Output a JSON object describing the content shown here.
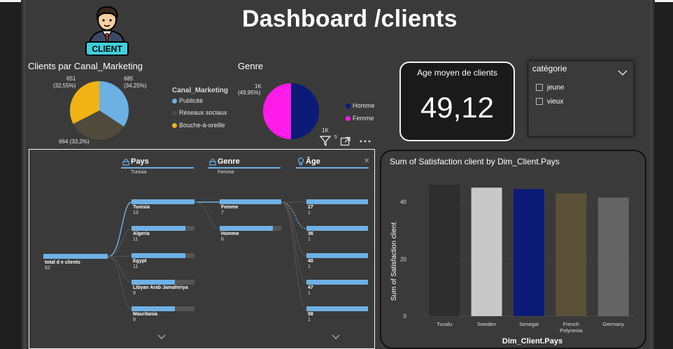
{
  "header": {
    "title": "Dashboard /clients",
    "logo_text": "CLIENT"
  },
  "canal": {
    "title": "Clients par Canal_Marketing",
    "legend_title": "Canal_Marketing",
    "slices": [
      {
        "name": "Publicité",
        "value": 685,
        "label": "685",
        "pct": "(34,25%)",
        "color": "#6cb0e4"
      },
      {
        "name": "Réseaux sociaux",
        "value": 664,
        "label": "664 (33,2%)",
        "pct": "",
        "color": "#4f4a3b"
      },
      {
        "name": "Bouche-à-oreille",
        "value": 651,
        "label": "651",
        "pct": "(32,55%)",
        "color": "#f1b214"
      }
    ]
  },
  "genre": {
    "title": "Genre",
    "slices": [
      {
        "name": "Homme",
        "value": 1000,
        "color": "#0c1a78"
      },
      {
        "name": "Femme",
        "value": 999,
        "color": "#ff1be9"
      }
    ],
    "label_top": "1K",
    "label_top_pct": "(49,95%)",
    "label_bottom": "1K",
    "label_bottom_suffix": "5"
  },
  "kpi": {
    "label": "Age moyen de clients",
    "value": "49,12"
  },
  "slicer": {
    "title": "catégorie",
    "options": [
      "jeune",
      "vieux"
    ]
  },
  "tree": {
    "root": {
      "label": "total d e clients",
      "value": "62"
    },
    "columns": [
      {
        "header": "Pays",
        "sub": "Tunisia"
      },
      {
        "header": "Genre",
        "sub": "Femme"
      },
      {
        "header": "Âge",
        "sub": ""
      }
    ],
    "pays": [
      {
        "label": "Tunisia",
        "value": "13",
        "fill": 1.0
      },
      {
        "label": "Algeria",
        "value": "11",
        "fill": 0.85
      },
      {
        "label": "Egypt",
        "value": "11",
        "fill": 0.85
      },
      {
        "label": "Libyan Arab Jamahiriya",
        "value": "9",
        "fill": 0.69
      },
      {
        "label": "Mauritania",
        "value": "9",
        "fill": 0.69
      }
    ],
    "genre": [
      {
        "label": "Femme",
        "value": "7",
        "fill": 1.0
      },
      {
        "label": "Homme",
        "value": "6",
        "fill": 0.86
      }
    ],
    "age": [
      {
        "label": "27",
        "value": "1",
        "fill": 1.0
      },
      {
        "label": "36",
        "value": "1",
        "fill": 1.0
      },
      {
        "label": "40",
        "value": "1",
        "fill": 1.0
      },
      {
        "label": "47",
        "value": "1",
        "fill": 1.0
      },
      {
        "label": "58",
        "value": "1",
        "fill": 1.0
      }
    ]
  },
  "chart_data": {
    "type": "bar",
    "title": "Sum of Satisfaction client by Dim_Client.Pays",
    "xlabel": "Dim_Client.Pays",
    "ylabel": "Sum of Satisfaction client",
    "categories": [
      "Tuvalu",
      "Sweden",
      "Senegal",
      "French Polynesia",
      "Germany"
    ],
    "values": [
      46,
      45,
      44.5,
      43,
      41.5
    ],
    "colors": [
      "#2e2e2e",
      "#c8c8c8",
      "#0c1a78",
      "#5a5138",
      "#646464"
    ],
    "yticks": [
      0,
      20,
      40
    ],
    "ylim": [
      0,
      48
    ]
  }
}
